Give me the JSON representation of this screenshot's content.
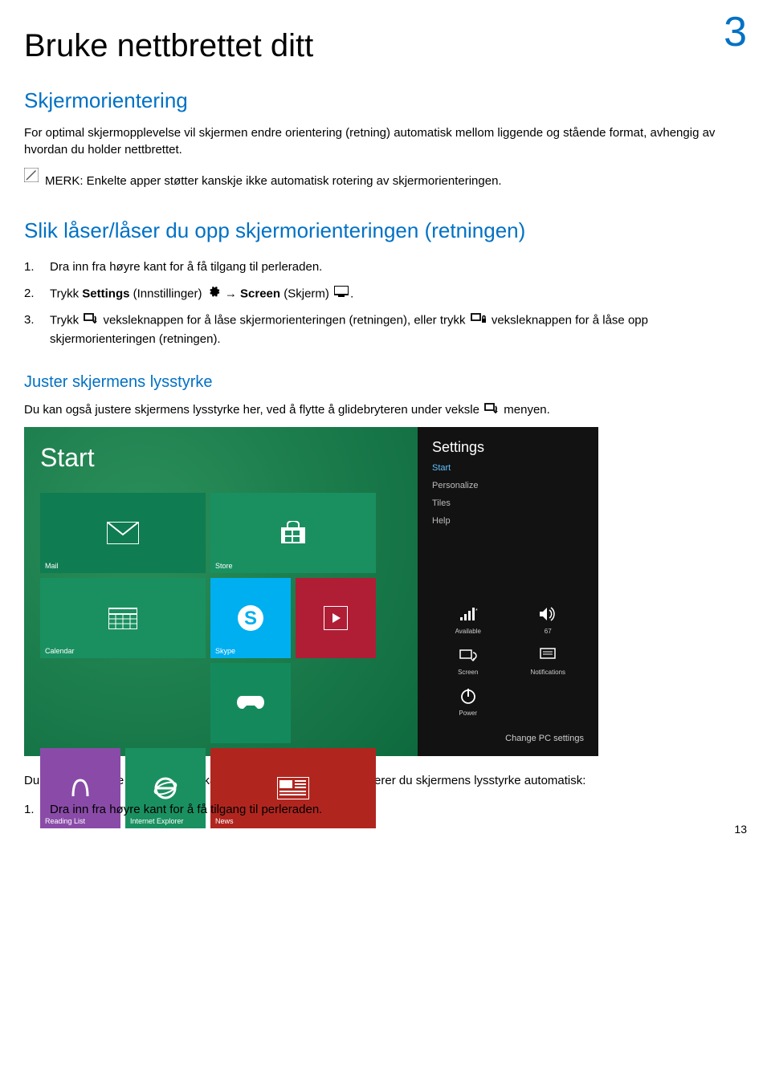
{
  "chapter_number": "3",
  "title": "Bruke nettbrettet ditt",
  "section1": {
    "heading": "Skjermorientering",
    "intro": "For optimal skjermopplevelse vil skjermen endre orientering (retning) automatisk mellom liggende og stående format, avhengig av hvordan du holder nettbrettet.",
    "note_label": "MERK:",
    "note_text": " Enkelte apper støtter kanskje ikke automatisk rotering av skjermorienteringen."
  },
  "section2": {
    "heading": "Slik låser/låser du opp skjermorienteringen (retningen)",
    "step1": "Dra inn fra høyre kant for å få tilgang til perleraden.",
    "step2_a": "Trykk ",
    "step2_b": "Settings",
    "step2_c": " (Innstillinger) ",
    "step2_d": " → ",
    "step2_e": "Screen",
    "step2_f": " (Skjerm) ",
    "step2_g": ".",
    "step3_a": "Trykk ",
    "step3_b": " veksleknappen for å låse skjermorienteringen (retningen), eller trykk ",
    "step3_c": " veksleknappen for å låse opp skjermorienteringen (retningen)."
  },
  "section3": {
    "heading": "Juster skjermens lysstyrke",
    "intro_a": "Du kan også justere skjermens lysstyrke her, ved å flytte å glidebryteren under veksle ",
    "intro_b": " menyen.",
    "outro": "Du kan også velge at lysstyrken skal justeres automatisk. Slik justerer du skjermens lysstyrke automatisk:",
    "step1": "Dra inn fra høyre kant for å få tilgang til perleraden."
  },
  "screenshot": {
    "start_label": "Start",
    "tiles": {
      "mail": "Mail",
      "store": "Store",
      "calendar": "Calendar",
      "skype": "Skype",
      "reading": "Reading List",
      "ie": "Internet Explorer",
      "news": "News"
    },
    "settings": {
      "title": "Settings",
      "items": [
        "Start",
        "Personalize",
        "Tiles",
        "Help"
      ],
      "quick": {
        "network": "Available",
        "volume": "67",
        "screen": "Screen",
        "notifications": "Notifications",
        "power": "Power"
      },
      "change_pc": "Change PC settings"
    }
  },
  "page_number": "13"
}
